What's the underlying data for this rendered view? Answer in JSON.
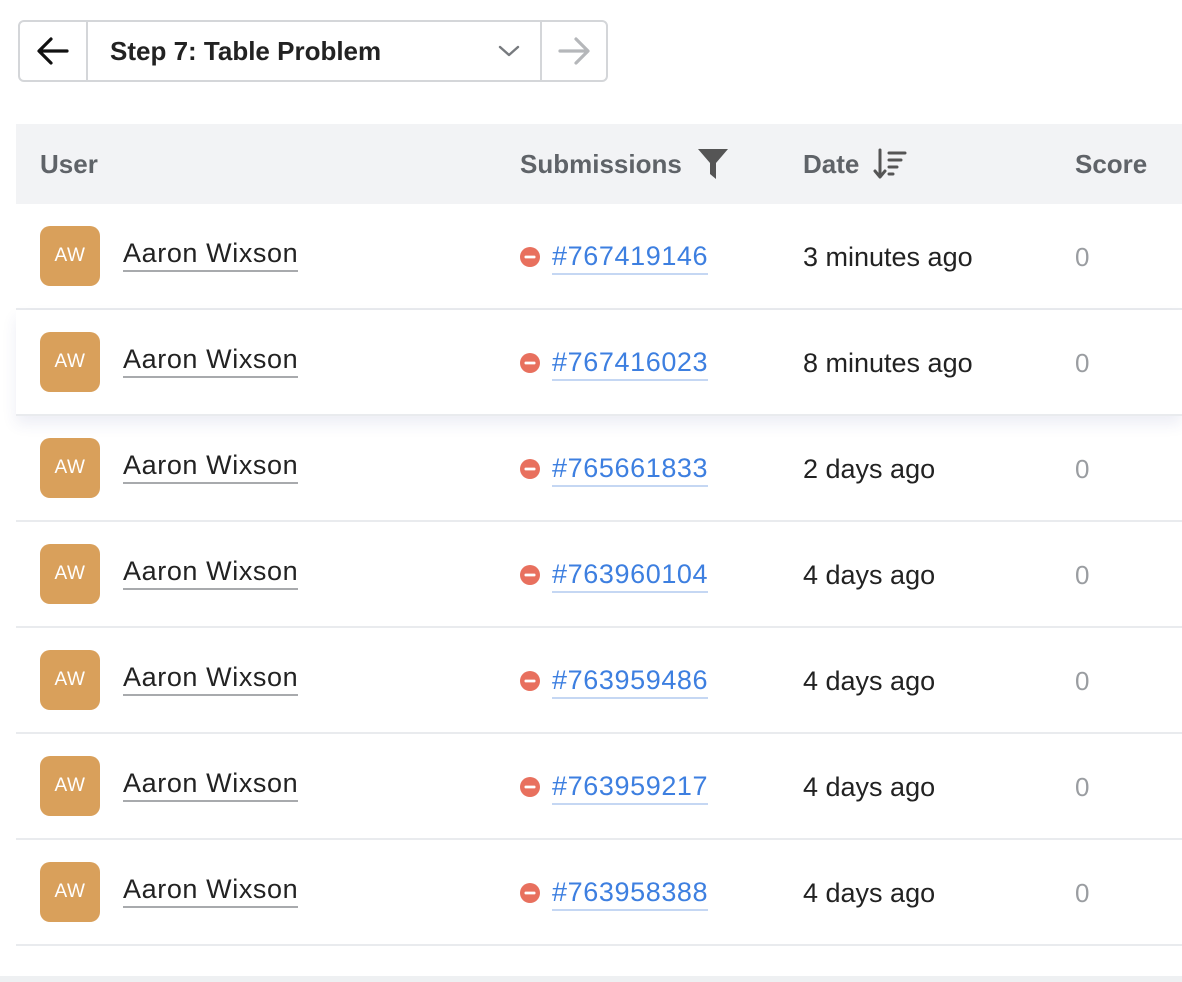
{
  "step_nav": {
    "title": "Step 7: Table Problem",
    "prev_icon": "arrow-left-icon",
    "next_icon": "arrow-right-icon",
    "dropdown_icon": "chevron-down-icon"
  },
  "table": {
    "headers": {
      "user": "User",
      "submissions": "Submissions",
      "date": "Date",
      "score": "Score"
    },
    "rows": [
      {
        "initials": "AW",
        "user": "Aaron Wixson",
        "status_icon": "minus-circle-icon",
        "submission": "#767419146",
        "date": "3 minutes ago",
        "score": "0"
      },
      {
        "initials": "AW",
        "user": "Aaron Wixson",
        "status_icon": "minus-circle-icon",
        "submission": "#767416023",
        "date": "8 minutes ago",
        "score": "0"
      },
      {
        "initials": "AW",
        "user": "Aaron Wixson",
        "status_icon": "minus-circle-icon",
        "submission": "#765661833",
        "date": "2 days ago",
        "score": "0"
      },
      {
        "initials": "AW",
        "user": "Aaron Wixson",
        "status_icon": "minus-circle-icon",
        "submission": "#763960104",
        "date": "4 days ago",
        "score": "0"
      },
      {
        "initials": "AW",
        "user": "Aaron Wixson",
        "status_icon": "minus-circle-icon",
        "submission": "#763959486",
        "date": "4 days ago",
        "score": "0"
      },
      {
        "initials": "AW",
        "user": "Aaron Wixson",
        "status_icon": "minus-circle-icon",
        "submission": "#763959217",
        "date": "4 days ago",
        "score": "0"
      },
      {
        "initials": "AW",
        "user": "Aaron Wixson",
        "status_icon": "minus-circle-icon",
        "submission": "#763958388",
        "date": "4 days ago",
        "score": "0"
      }
    ]
  },
  "colors": {
    "avatar": "#d9a05b",
    "link": "#3d7fe0",
    "status_wrong": "#e8705e",
    "header_bg": "#f2f3f5"
  }
}
